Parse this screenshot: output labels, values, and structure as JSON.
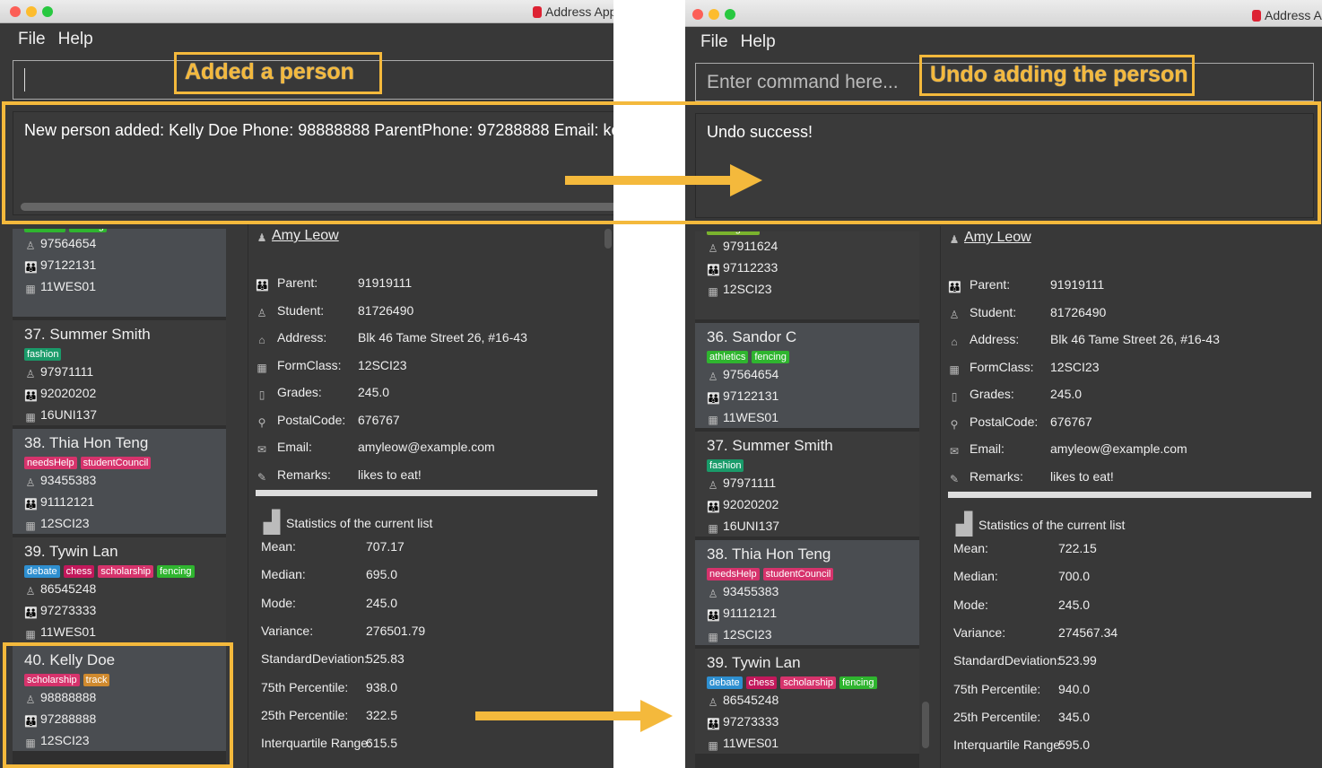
{
  "app_title": "Address App",
  "menu": {
    "file": "File",
    "help": "Help"
  },
  "colors": {
    "annotation": "#f4b93c",
    "background": "#383838"
  },
  "tag_colors": {
    "athletics": "#2fb52f",
    "fencing": "#2fb52f",
    "fashion": "#1a9b6a",
    "needsHelp": "#d6336c",
    "studentCouncil": "#d6336c",
    "debate": "#2e8fd0",
    "chess": "#c2185b",
    "scholarship": "#d6336c",
    "track": "#d08a2e",
    "colleagues": "#7ab32e"
  },
  "annotations": {
    "left_label": "Added a person",
    "right_label": "Undo adding the person"
  },
  "before": {
    "command_value": "",
    "result": "New person added: Kelly Doe Phone: 98888888 ParentPhone: 97288888 Email: kelldoe@",
    "persons": [
      {
        "name": "",
        "tags": [
          "athletics",
          "fencing"
        ],
        "phone": "97564654",
        "parent": "97122131",
        "formclass": "11WES01"
      },
      {
        "name": "37.  Summer Smith",
        "tags": [
          "fashion"
        ],
        "phone": "97971111",
        "parent": "92020202",
        "formclass": "16UNI137"
      },
      {
        "name": "38.  Thia Hon Teng",
        "tags": [
          "needsHelp",
          "studentCouncil"
        ],
        "phone": "93455383",
        "parent": "91112121",
        "formclass": "12SCI23"
      },
      {
        "name": "39.  Tywin Lan",
        "tags": [
          "debate",
          "chess",
          "scholarship",
          "fencing"
        ],
        "phone": "86545248",
        "parent": "97273333",
        "formclass": "11WES01"
      },
      {
        "name": "40.  Kelly Doe",
        "tags": [
          "scholarship",
          "track"
        ],
        "phone": "98888888",
        "parent": "97288888",
        "formclass": "12SCI23"
      }
    ],
    "stats": [
      [
        "Mean:",
        "707.17"
      ],
      [
        "Median:",
        "695.0"
      ],
      [
        "Mode:",
        "245.0"
      ],
      [
        "Variance:",
        "276501.79"
      ],
      [
        "StandardDeviation:",
        "525.83"
      ],
      [
        "75th Percentile:",
        "938.0"
      ],
      [
        "25th Percentile:",
        "322.5"
      ],
      [
        "Interquartile Range:",
        "615.5"
      ]
    ]
  },
  "after": {
    "command_placeholder": "Enter command here...",
    "result": "Undo success!",
    "persons": [
      {
        "name": "",
        "tags": [
          "colleagues"
        ],
        "phone": "97911624",
        "parent": "97112233",
        "formclass": "12SCI23"
      },
      {
        "name": "36.  Sandor C",
        "tags": [
          "athletics",
          "fencing"
        ],
        "phone": "97564654",
        "parent": "97122131",
        "formclass": "11WES01"
      },
      {
        "name": "37.  Summer Smith",
        "tags": [
          "fashion"
        ],
        "phone": "97971111",
        "parent": "92020202",
        "formclass": "16UNI137"
      },
      {
        "name": "38.  Thia Hon Teng",
        "tags": [
          "needsHelp",
          "studentCouncil"
        ],
        "phone": "93455383",
        "parent": "91112121",
        "formclass": "12SCI23"
      },
      {
        "name": "39.  Tywin Lan",
        "tags": [
          "debate",
          "chess",
          "scholarship",
          "fencing"
        ],
        "phone": "86545248",
        "parent": "97273333",
        "formclass": "11WES01"
      }
    ],
    "stats": [
      [
        "Mean:",
        "722.15"
      ],
      [
        "Median:",
        "700.0"
      ],
      [
        "Mode:",
        "245.0"
      ],
      [
        "Variance:",
        "274567.34"
      ],
      [
        "StandardDeviation:",
        "523.99"
      ],
      [
        "75th Percentile:",
        "940.0"
      ],
      [
        "25th Percentile:",
        "345.0"
      ],
      [
        "Interquartile Range:",
        "595.0"
      ]
    ]
  },
  "detail": {
    "name": "Amy Leow",
    "rows": [
      {
        "icon": "parent-icon",
        "label": "Parent:",
        "value": "91919111"
      },
      {
        "icon": "student-icon",
        "label": "Student:",
        "value": "81726490"
      },
      {
        "icon": "home-icon",
        "label": "Address:",
        "value": "Blk 46 Tame Street 26, #16-43"
      },
      {
        "icon": "formclass-icon",
        "label": "FormClass:",
        "value": "12SCI23"
      },
      {
        "icon": "grades-icon",
        "label": "Grades:",
        "value": "245.0"
      },
      {
        "icon": "location-pin-icon",
        "label": "PostalCode:",
        "value": "676767"
      },
      {
        "icon": "envelope-icon",
        "label": "Email:",
        "value": "amyleow@example.com"
      },
      {
        "icon": "pencil-icon",
        "label": "Remarks:",
        "value": "likes to eat!"
      }
    ],
    "stats_title": "Statistics of the current list"
  }
}
